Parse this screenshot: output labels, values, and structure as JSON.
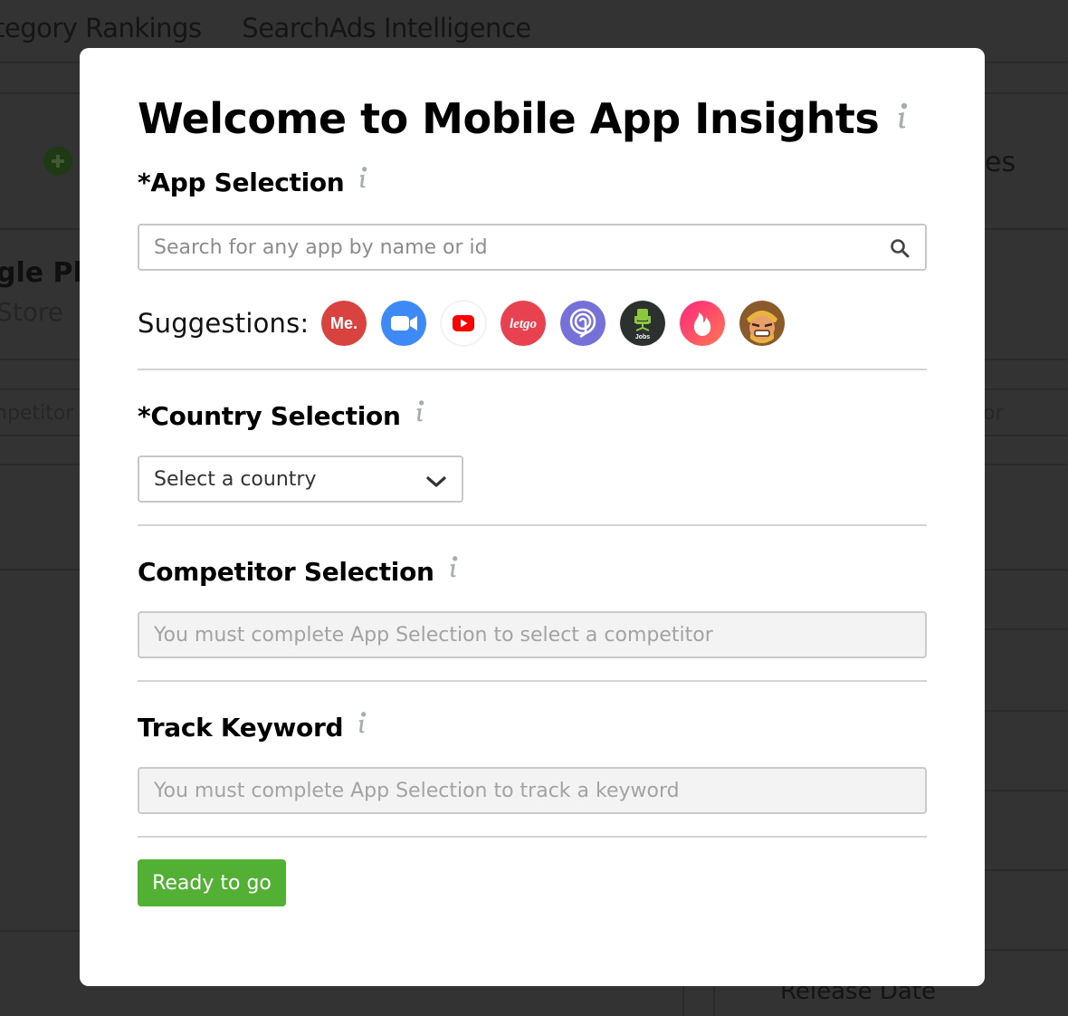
{
  "background": {
    "tabs": [
      "tegory Rankings",
      "SearchAds Intelligence"
    ],
    "store_title": "gle Pl",
    "store_subtitle": "Store",
    "competitor_left": "npetitor",
    "right_header_fragment": "es",
    "competitor_right": "or",
    "release_date": "Release Date"
  },
  "modal": {
    "title": "Welcome to Mobile App Insights",
    "app_selection": {
      "heading": "*App Selection",
      "search_placeholder": "Search for any app by name or id",
      "suggestions_label": "Suggestions:",
      "suggestions": [
        {
          "name": "Me.",
          "icon": "me-app-icon",
          "color": "#d9433f"
        },
        {
          "name": "Zoom",
          "icon": "zoom-app-icon",
          "color": "#3d8af7"
        },
        {
          "name": "YouTube",
          "icon": "youtube-app-icon",
          "color": "#ff0000"
        },
        {
          "name": "letgo",
          "icon": "letgo-app-icon",
          "color": "#e8414f"
        },
        {
          "name": "Life360",
          "icon": "life360-app-icon",
          "color": "#7671d8"
        },
        {
          "name": "Jobs",
          "icon": "jobs-app-icon",
          "color": "#2c3130"
        },
        {
          "name": "Tinder",
          "icon": "tinder-app-icon",
          "color": "#fd4f68"
        },
        {
          "name": "Clash of Clans",
          "icon": "clash-of-clans-app-icon",
          "color": "#c8892e"
        }
      ]
    },
    "country_selection": {
      "heading": "*Country Selection",
      "selected": "Select a country"
    },
    "competitor_selection": {
      "heading": "Competitor Selection",
      "placeholder": "You must complete App Selection to select a competitor"
    },
    "track_keyword": {
      "heading": "Track Keyword",
      "placeholder": "You must complete App Selection to track a keyword"
    },
    "submit_label": "Ready to go",
    "colors": {
      "primary_button": "#52b035",
      "info_icon": "#a7adad"
    }
  }
}
